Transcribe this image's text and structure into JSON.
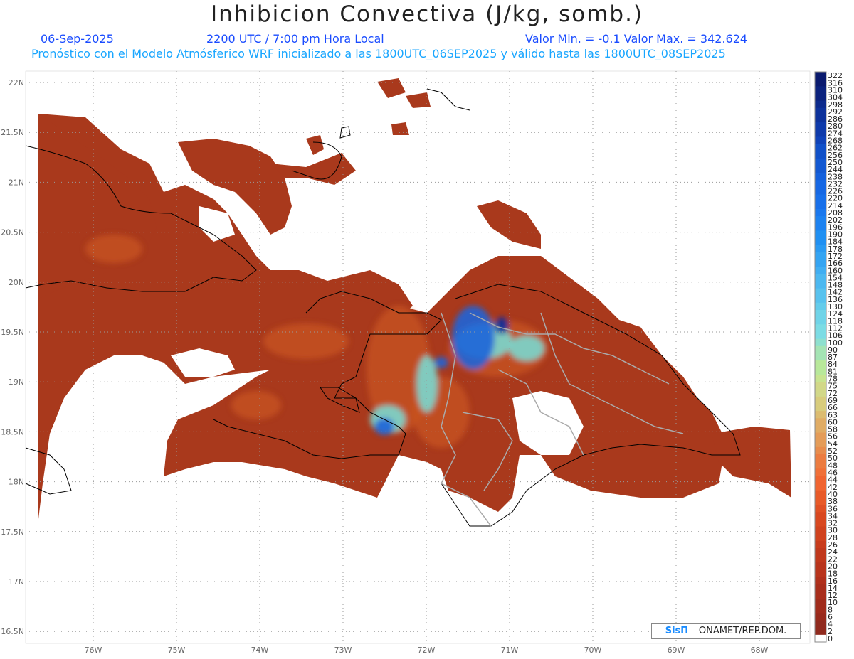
{
  "title": "Inhibicion Convectiva (J/kg, somb.)",
  "date": "06-Sep-2025",
  "time": "2200 UTC / 7:00 pm Hora Local",
  "min_max": "Valor Min. = -0.1  Valor Max. = 342.624",
  "subtitle": "Pronóstico con el Modelo Atmósferico WRF inicializado a las 1800UTC_06SEP2025 y válido hasta las  1800UTC_08SEP2025",
  "credit": {
    "logo": "SisΠ",
    "text": " – ONAMET/REP.DOM."
  },
  "lat_labels": [
    "22N",
    "21.5N",
    "21N",
    "20.5N",
    "20N",
    "19.5N",
    "19N",
    "18.5N",
    "18N",
    "17.5N",
    "17N",
    "16.5N"
  ],
  "lon_labels": [
    "76W",
    "75W",
    "74W",
    "73W",
    "72W",
    "71W",
    "70W",
    "69W",
    "68W"
  ],
  "colorbar_labels": [
    "322",
    "316",
    "310",
    "304",
    "298",
    "292",
    "286",
    "280",
    "274",
    "268",
    "262",
    "256",
    "250",
    "244",
    "238",
    "232",
    "226",
    "220",
    "214",
    "208",
    "202",
    "196",
    "190",
    "184",
    "178",
    "172",
    "166",
    "160",
    "154",
    "148",
    "142",
    "136",
    "130",
    "124",
    "118",
    "112",
    "106",
    "100",
    "90",
    "87",
    "84",
    "81",
    "78",
    "75",
    "72",
    "69",
    "66",
    "63",
    "60",
    "58",
    "56",
    "54",
    "52",
    "50",
    "48",
    "46",
    "44",
    "42",
    "40",
    "38",
    "36",
    "34",
    "32",
    "30",
    "28",
    "26",
    "24",
    "22",
    "20",
    "18",
    "16",
    "14",
    "12",
    "10",
    "8",
    "6",
    "4",
    "2",
    "0"
  ],
  "colorbar_colors": [
    "#0a1a6e",
    "#0b227d",
    "#0c2a8c",
    "#0d329b",
    "#0e3aaa",
    "#0f42b8",
    "#1050c8",
    "#1258d2",
    "#1460dc",
    "#1668e4",
    "#1870ea",
    "#1a78ee",
    "#1d82f0",
    "#2090f2",
    "#2a9af2",
    "#34a4f2",
    "#40aef2",
    "#4cb8f0",
    "#58c2ee",
    "#64cceb",
    "#70d4e8",
    "#7cdce4",
    "#8ee0cf",
    "#a4e4b4",
    "#b8e89a",
    "#c8e490",
    "#d2d888",
    "#d8cc7c",
    "#dcbc70",
    "#e0ac64",
    "#e49c58",
    "#e88c4c",
    "#ec7c40",
    "#f07038",
    "#f06430",
    "#e85a28",
    "#e05024",
    "#d84820",
    "#d0421e",
    "#c83c1c",
    "#c0381c",
    "#b8341c",
    "#b0301c",
    "#a82e1c",
    "#a02c1c",
    "#982a1c",
    "#902a1e",
    "#ffffff"
  ],
  "field_colors": {
    "base": "#a9391c",
    "warm": "#c8541f",
    "hot": "#e07a2a",
    "tan": "#d8b070",
    "teal": "#7ad8d0",
    "blue": "#1e64d8",
    "deep": "#0a2c9c"
  }
}
